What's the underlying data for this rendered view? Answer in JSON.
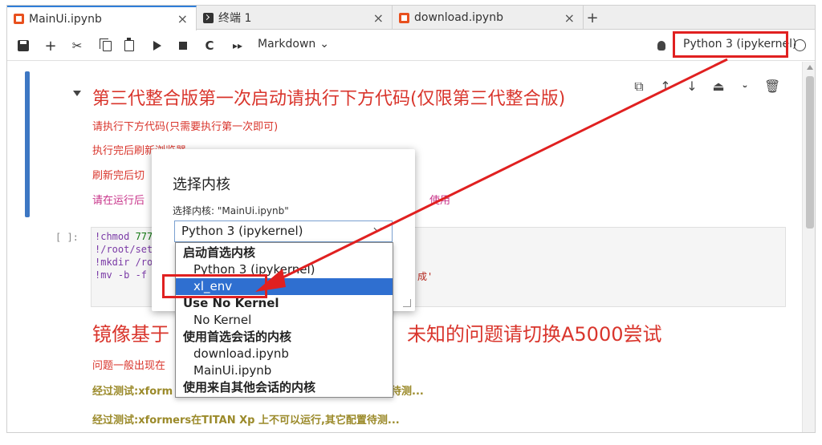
{
  "tabs": [
    {
      "label": "MainUi.ipynb",
      "icon": "notebook-icon",
      "active": true
    },
    {
      "label": "终端 1",
      "icon": "terminal-icon",
      "active": false
    },
    {
      "label": "download.ipynb",
      "icon": "notebook-icon",
      "active": false
    }
  ],
  "tab_close": "×",
  "tab_add": "+",
  "toolbar": {
    "add": "+",
    "cut": "✂",
    "restart": "C",
    "run_all": "▸▸",
    "cell_type": "Markdown",
    "cell_type_caret": "⌄",
    "kernel": "Python 3 (ipykernel)"
  },
  "cell_tools": [
    "⧉",
    "↑",
    "↓",
    "⏏",
    "⏑",
    "🗑"
  ],
  "markdown": {
    "title": "第三代整合版第一次启动请执行下方代码(仅限第三代整合版)",
    "lines": [
      "请执行下方代码(只需要执行第一次即可)",
      "执行完后刷新浏览器",
      "刷新完后切",
      "请在运行后"
    ],
    "line4_tail": "使用"
  },
  "code": {
    "prompt": "[ ]:",
    "lines": [
      {
        "a": "!chmod ",
        "b": "777"
      },
      {
        "a": "!/root/set",
        "b": ""
      },
      {
        "a": "!mkdir /ro",
        "b": ""
      },
      {
        "a": "!mv -b -f ",
        "b": ""
      }
    ],
    "line4_tail": "成'"
  },
  "section": {
    "title_left": "镜像基于",
    "title_right": "未知的问题请切换A5000尝试",
    "p1": "问题一般出现在",
    "p2": "经过测试:xform",
    "p2_tail": "待测...",
    "p3": "经过测试:xformers在TITAN Xp 上不可以运行,其它配置待测..."
  },
  "dialog": {
    "title": "选择内核",
    "label": "选择内核: \"MainUi.ipynb\"",
    "selected": "Python 3 (ipykernel)"
  },
  "dropdown": [
    {
      "label": "启动首选内核",
      "group": true
    },
    {
      "label": "Python 3 (ipykernel)",
      "group": false
    },
    {
      "label": "xl_env",
      "group": false,
      "selected": true
    },
    {
      "label": "Use No Kernel",
      "group": true
    },
    {
      "label": "No Kernel",
      "group": false
    },
    {
      "label": "使用首选会话的内核",
      "group": true
    },
    {
      "label": "download.ipynb",
      "group": false
    },
    {
      "label": "MainUi.ipynb",
      "group": false
    },
    {
      "label": "使用来自其他会话的内核",
      "group": true
    }
  ],
  "colors": {
    "accent": "#2f6fd0",
    "annotation": "#e02020",
    "heading": "#d9352c"
  }
}
